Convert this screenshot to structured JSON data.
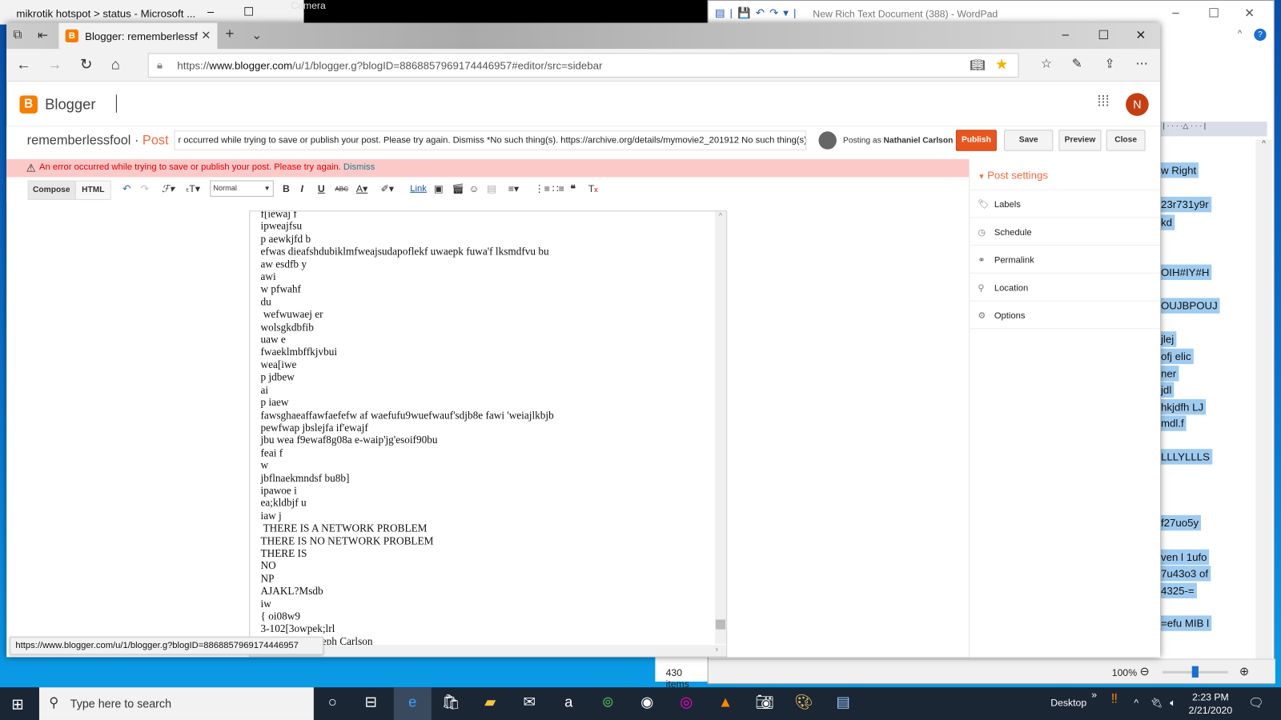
{
  "background_windows": {
    "mikrotik_title": "mikrotik hotspot > status - Microsoft ...",
    "camera_title": "Camera",
    "wordpad": {
      "title": "New Rich Text Document (388) - WordPad",
      "visible_lines": [
        "w Right",
        "23r731y9r",
        "kd",
        "OIH#IY#H",
        "OUJBPOUJ",
        "jlej",
        "ofj elic",
        "ner",
        "jdl",
        "hkjdfh LJ",
        "mdl.f",
        "LLLYLLLS",
        "f27uo5y",
        "ven l 1ufo",
        "7u43o3 of",
        "4325-=",
        "=efu MIB l"
      ],
      "zoom": "100%",
      "zoom_level": 0.5
    },
    "explorer_status": "430 items"
  },
  "browser": {
    "tab_title": "Blogger: rememberlessf",
    "url_prefix": "https://",
    "url_domain": "www.blogger.com",
    "url_rest": "/u/1/blogger.g?blogID=8868857969174446957#editor/src=sidebar",
    "favorited": true,
    "status_tooltip": "https://www.blogger.com/u/1/blogger.g?blogID=8868857969174446957"
  },
  "blogger": {
    "brand": "Blogger",
    "avatar_initial": "N",
    "blog_name": "rememberlessfool",
    "separator": " · ",
    "post_label": "Post",
    "title_value": "r occurred while trying to save or publish your post. Please try again. Dismiss *No such thing(s). https://archive.org/details/mymovie2_201912  No such thing(s).",
    "posting_as_label": "Posting as",
    "posting_as_name": "Nathaniel Carlson",
    "buttons": {
      "publish": "Publish",
      "save": "Save",
      "preview": "Preview",
      "close": "Close"
    },
    "error_message": "An error occurred while trying to save or publish your post. Please try again.",
    "error_dismiss": "Dismiss",
    "toolbar": {
      "compose": "Compose",
      "html": "HTML",
      "format": "Normal",
      "link": "Link"
    },
    "editor_lines": [
      "f[iewaj f",
      "ipweajfsu",
      "p aewkjfd b",
      "efwas dieafshdubiklmfweajsudapoflekf uwaepk fuwa'f lksmdfvu bu",
      "aw esdfb y",
      "awi",
      "w pfwahf",
      "du",
      " wefwuwaej er",
      "wolsgkdbfib",
      "uaw e",
      "fwaeklmbffkjvbui",
      "wea[iwe",
      "p jdbew",
      "ai",
      "p iaew",
      "fawsghaeaffawfaefefw af waefufu9wuefwauf'sdjb8e fawi 'weiajlkbjb",
      "pewfwap jbslejfa if'ewajf",
      "jbu wea f9ewaf8g08a e-waip'jg'esoif90bu",
      "feai f",
      "w",
      "jbflnaekmndsf bu8b]",
      "ipawoe i",
      "ea;kldbjf u",
      "iaw j",
      " THERE IS A NETWORK PROBLEM",
      "THERE IS NO NETWORK PROBLEM",
      "THERE IS",
      "NO",
      "NP",
      "AJAKL?Msdb",
      "iw",
      "{ oi08w9",
      "3-102[3owpek;lrl",
      "-Nathaniel Joseph Carlson"
    ],
    "post_settings": {
      "heading": "Post settings",
      "items": [
        {
          "label": "Labels",
          "icon": "tag-icon"
        },
        {
          "label": "Schedule",
          "icon": "clock-icon"
        },
        {
          "label": "Permalink",
          "icon": "link-icon"
        },
        {
          "label": "Location",
          "icon": "pin-icon"
        },
        {
          "label": "Options",
          "icon": "gear-icon"
        }
      ]
    }
  },
  "taskbar": {
    "search_placeholder": "Type here to search",
    "desktop_label": "Desktop",
    "time": "2:23 PM",
    "date": "2/21/2020"
  },
  "colors": {
    "blogger_orange": "#f57d00",
    "publish": "#e8561f",
    "error_bg": "#fcc9c9",
    "selection": "#9fcbf0"
  }
}
